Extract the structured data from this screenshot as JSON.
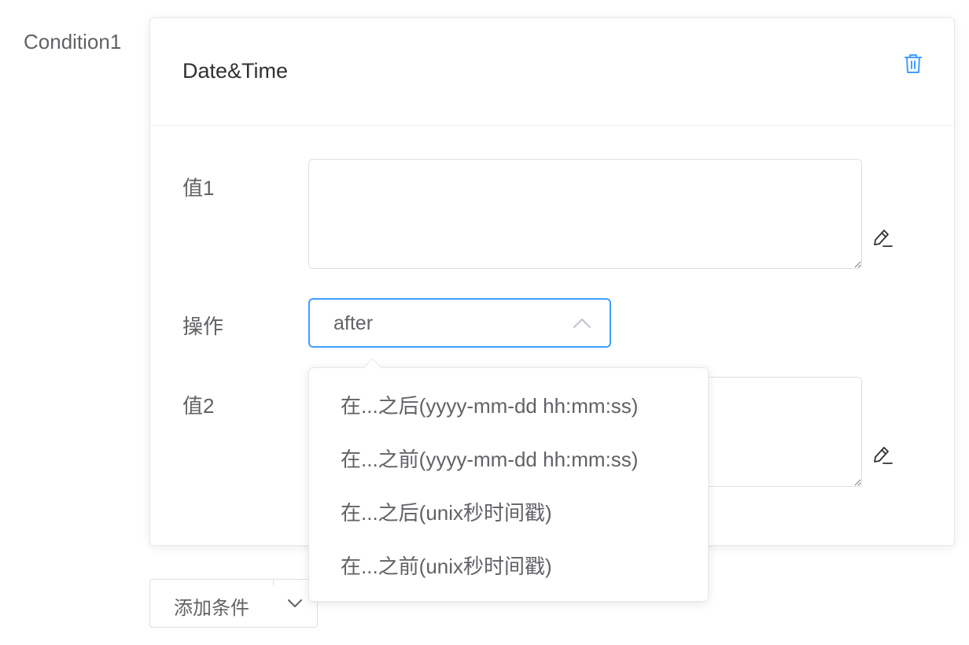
{
  "condition": {
    "label": "Condition1",
    "card_title": "Date&Time",
    "delete_icon": "trash-icon"
  },
  "form": {
    "value1_label": "值1",
    "value1_text": "",
    "operation_label": "操作",
    "operation_value": "after",
    "value2_label": "值2",
    "value2_text": "",
    "edit_icon": "pencil-icon"
  },
  "dropdown": {
    "options": [
      "在...之后(yyyy-mm-dd hh:mm:ss)",
      "在...之前(yyyy-mm-dd hh:mm:ss)",
      "在...之后(unix秒时间戳)",
      "在...之前(unix秒时间戳)"
    ]
  },
  "add_condition": {
    "label": "添加条件"
  },
  "colors": {
    "accent": "#409eff",
    "text": "#606266",
    "border": "#dcdfe6"
  }
}
